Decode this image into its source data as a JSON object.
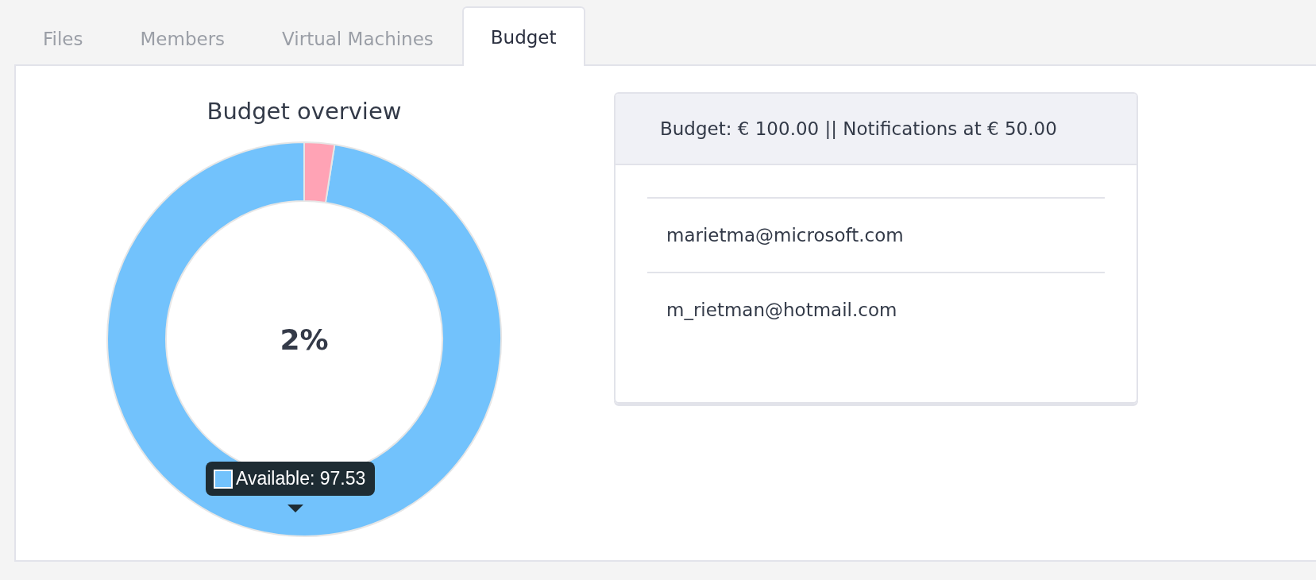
{
  "tabs": [
    {
      "label": "Files",
      "selected": false
    },
    {
      "label": "Members",
      "selected": false
    },
    {
      "label": "Virtual Machines",
      "selected": false
    },
    {
      "label": "Budget",
      "selected": true
    }
  ],
  "budget_chart": {
    "title": "Budget overview",
    "center_label": "2%",
    "tooltip": "Available: 97.53"
  },
  "budget_card": {
    "header": "Budget: € 100.00 || Notifications at € 50.00",
    "emails": [
      "marietma@microsoft.com",
      "m_rietman@hotmail.com"
    ]
  }
}
